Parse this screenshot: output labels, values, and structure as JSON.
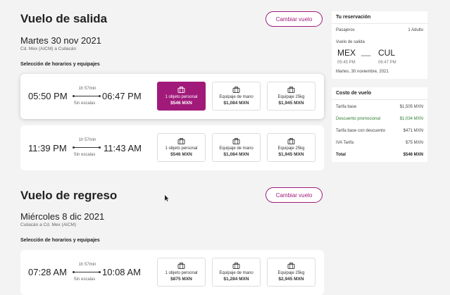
{
  "outbound": {
    "title": "Vuelo de salida",
    "change_label": "Cambiar vuelo",
    "date": "Martes 30 nov 2021",
    "route": "Cd. Mex (AICM) a Culiacán",
    "selection_label": "Selección de horarios y equipajes",
    "flights": [
      {
        "depart": "05:50 PM",
        "arrive": "06:47 PM",
        "duration": "1h 57min",
        "stops": "Sin escalas",
        "options": [
          {
            "name": "1 objeto personal",
            "price": "$546 MXN",
            "selected": true
          },
          {
            "name": "Equipaje de mano",
            "price": "$1,084 MXN",
            "selected": false
          },
          {
            "name": "Equipaje 25kg",
            "price": "$1,945 MXN",
            "selected": false
          }
        ]
      },
      {
        "depart": "11:39 PM",
        "arrive": "11:43 AM",
        "duration": "1h 57min",
        "stops": "Sin escalas",
        "options": [
          {
            "name": "1 objeto personal",
            "price": "$546 MXN",
            "selected": false
          },
          {
            "name": "Equipaje de mano",
            "price": "$1,084 MXN",
            "selected": false
          },
          {
            "name": "Equipaje 25kg",
            "price": "$1,945 MXN",
            "selected": false
          }
        ]
      }
    ]
  },
  "return": {
    "title": "Vuelo de regreso",
    "change_label": "Cambiar vuelo",
    "date": "Miércoles 8 dic 2021",
    "route": "Culiacán a Cd. Mex (AICM)",
    "selection_label": "Selección de horarios y equipajes",
    "flights": [
      {
        "depart": "07:28 AM",
        "arrive": "10:08 AM",
        "duration": "1h 57min",
        "stops": "Sin escalas",
        "options": [
          {
            "name": "1 objeto personal",
            "price": "$875 MXN",
            "selected": false
          },
          {
            "name": "Equipaje de mano",
            "price": "$1,284 MXN",
            "selected": false
          },
          {
            "name": "Equipaje 25kg",
            "price": "$2,945 MXN",
            "selected": false
          }
        ]
      }
    ]
  },
  "reservation": {
    "title": "Tu reservación",
    "passengers_label": "Pasajeros",
    "passengers_value": "1 Adulto",
    "flight_label": "Vuelo de salida",
    "origin": "MEX",
    "separator": "__",
    "destination": "CUL",
    "depart_time": "05:45 PM",
    "arrive_time": "06:47 PM",
    "date": "Martes, 30 noviembre, 2021"
  },
  "cost": {
    "title": "Costo de vuelo",
    "rows": [
      {
        "label": "Tarifa base",
        "value": "$1,505 MXN"
      },
      {
        "label": "Descuento promocional",
        "value": "$1,034 MXN"
      },
      {
        "label": "Tarifa base con descuento",
        "value": "$471 MXN"
      },
      {
        "label": "IVA Tarifa",
        "value": "$75 MXN"
      },
      {
        "label": "Total",
        "value": "$546 MXN"
      }
    ]
  },
  "colors": {
    "accent": "#a11a7a",
    "promo": "#2e7d32"
  }
}
